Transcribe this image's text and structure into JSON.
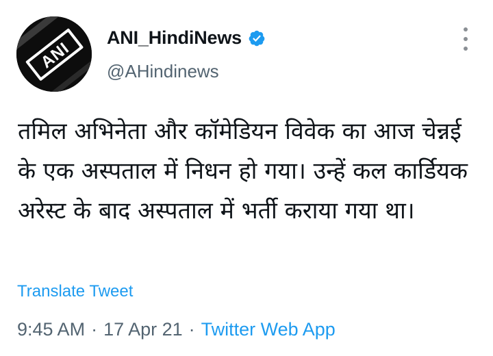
{
  "tweet": {
    "display_name": "ANI_HindiNews",
    "handle": "@AHindinews",
    "avatar_logo_text": "ANI",
    "verified_icon": "verified-badge-icon",
    "more_icon": "more-vertical-icon",
    "text": "तमिल अभिनेता और कॉमेडियन विवेक का आज चेन्नई के एक अस्पताल में निधन हो गया। उन्हें कल कार्डियक अरेस्ट के बाद अस्पताल में भर्ती कराया गया था।",
    "translate_label": "Translate Tweet",
    "time": "9:45 AM",
    "separator": "·",
    "date": "17 Apr 21",
    "source": "Twitter Web App"
  },
  "colors": {
    "accent": "#1d9bf0",
    "text_primary": "#0f1419",
    "text_secondary": "#536471",
    "avatar_bg": "#0d0d0d"
  }
}
